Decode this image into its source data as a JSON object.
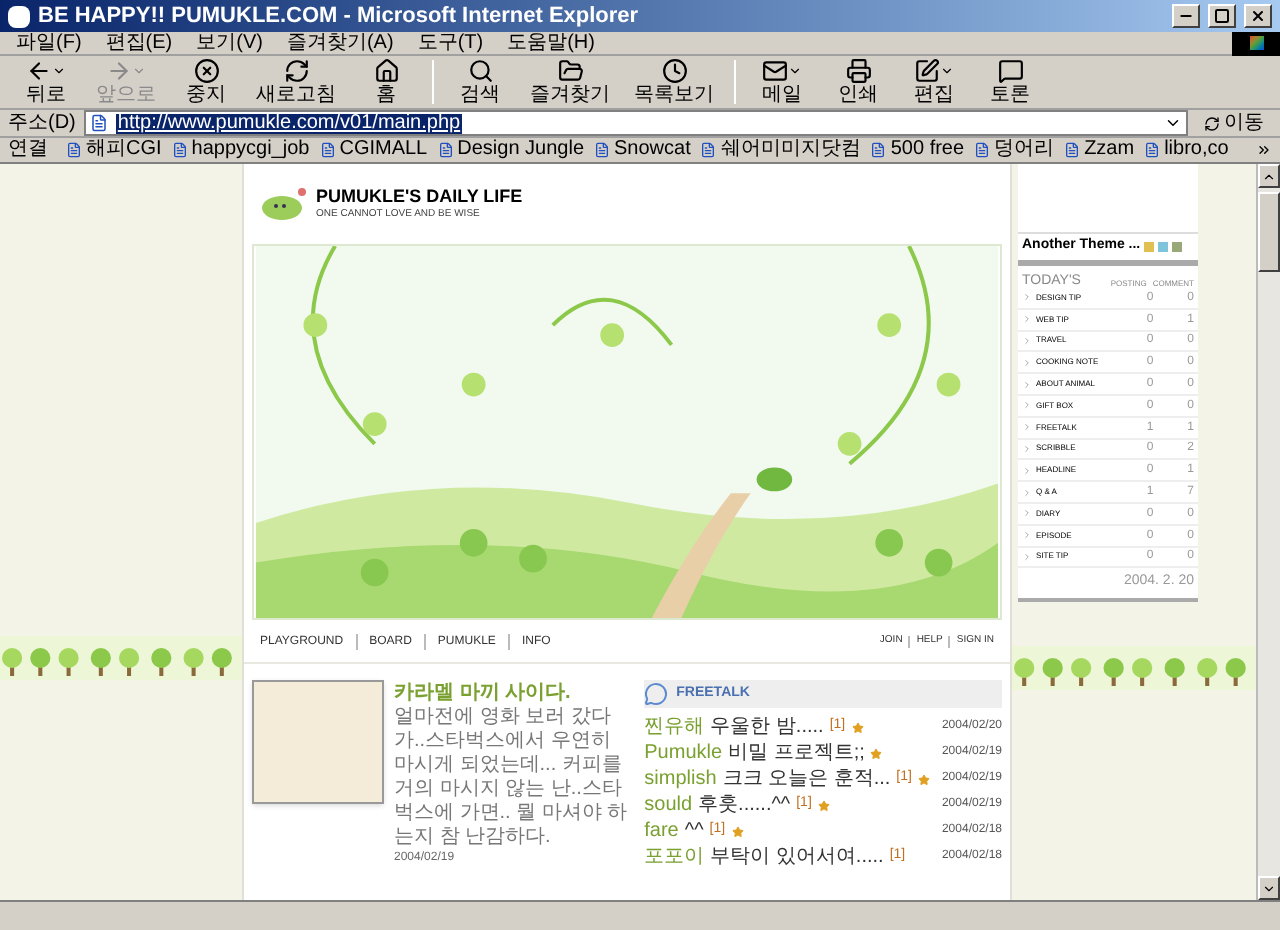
{
  "window": {
    "title": "BE HAPPY!! PUMUKLE.COM - Microsoft Internet Explorer"
  },
  "menu": [
    "파일(F)",
    "편집(E)",
    "보기(V)",
    "즐겨찾기(A)",
    "도구(T)",
    "도움말(H)"
  ],
  "toolbar": [
    {
      "label": "뒤로",
      "disabled": false,
      "dropdown": true
    },
    {
      "label": "앞으로",
      "disabled": true,
      "dropdown": true
    },
    {
      "label": "중지",
      "disabled": false,
      "dropdown": false
    },
    {
      "label": "새로고침",
      "disabled": false,
      "dropdown": false
    },
    {
      "label": "홈",
      "disabled": false,
      "dropdown": false
    },
    {
      "label": "검색",
      "disabled": false,
      "dropdown": false
    },
    {
      "label": "즐겨찾기",
      "disabled": false,
      "dropdown": false
    },
    {
      "label": "목록보기",
      "disabled": false,
      "dropdown": false
    },
    {
      "label": "메일",
      "disabled": false,
      "dropdown": true
    },
    {
      "label": "인쇄",
      "disabled": false,
      "dropdown": false
    },
    {
      "label": "편집",
      "disabled": false,
      "dropdown": true
    },
    {
      "label": "토론",
      "disabled": false,
      "dropdown": false
    }
  ],
  "address": {
    "label": "주소(D)",
    "value": "http://www.pumukle.com/v01/main.php",
    "go": "이동"
  },
  "links": {
    "label": "연결",
    "items": [
      "해피CGI",
      "happycgi_job",
      "CGIMALL",
      "Design Jungle",
      "Snowcat",
      "쉐어미미지닷컴",
      "500 free",
      "덩어리",
      "Zzam",
      "libro,co"
    ]
  },
  "page": {
    "logo": {
      "title": "PUMUKLE'S DAILY LIFE",
      "subtitle": "ONE CANNOT LOVE AND BE WISE"
    },
    "nav": [
      "PLAYGROUND",
      "BOARD",
      "PUMUKLE",
      "INFO"
    ],
    "member_links": [
      "JOIN",
      "HELP",
      "SIGN IN"
    ],
    "post": {
      "title": "카라멜 마끼 사이다.",
      "body": "얼마전에 영화 보러 갔다가..스타벅스에서 우연히 마시게 되었는데... 커피를 거의 마시지 않는 난..스타벅스에 가면.. 뭘 마셔야 하는지 참 난감하다.",
      "date": "2004/02/19"
    },
    "freetalk": {
      "title": "FREETALK",
      "rows": [
        {
          "author": "찐유해",
          "title": "우울한 밤.....",
          "count": "[1]",
          "new": true,
          "date": "2004/02/20"
        },
        {
          "author": "Pumukle",
          "title": "비밀 프로젝트;;",
          "new": true,
          "date": "2004/02/19"
        },
        {
          "author": "simplish",
          "title": "크크 오늘은 훈적...",
          "count": "[1]",
          "new": true,
          "date": "2004/02/19"
        },
        {
          "author": "sould",
          "title": "후훗......^^",
          "count": "[1]",
          "new": true,
          "date": "2004/02/19"
        },
        {
          "author": "fare",
          "title": "^^",
          "count": "[1]",
          "new": true,
          "date": "2004/02/18"
        },
        {
          "author": "포포이",
          "title": "부탁이 있어서여.....",
          "count": "[1]",
          "new": false,
          "date": "2004/02/18"
        }
      ]
    }
  },
  "sidebar": {
    "theme_title": "Another Theme ...",
    "themes": [
      {
        "color": "#e0c050"
      },
      {
        "color": "#80c4dc"
      },
      {
        "color": "#98a878"
      }
    ],
    "columns": [
      "TODAY'S",
      "POSTING",
      "COMMENT"
    ],
    "rows": [
      {
        "label": "DESIGN TIP",
        "posting": "0",
        "comment": "0"
      },
      {
        "label": "WEB TIP",
        "posting": "0",
        "comment": "1"
      },
      {
        "label": "TRAVEL",
        "posting": "0",
        "comment": "0"
      },
      {
        "label": "COOKING NOTE",
        "posting": "0",
        "comment": "0"
      },
      {
        "label": "ABOUT ANIMAL",
        "posting": "0",
        "comment": "0"
      },
      {
        "label": "GIFT BOX",
        "posting": "0",
        "comment": "0"
      },
      {
        "label": "FREETALK",
        "posting": "1",
        "comment": "1"
      },
      {
        "label": "SCRIBBLE",
        "posting": "0",
        "comment": "2"
      },
      {
        "label": "HEADLINE",
        "posting": "0",
        "comment": "1"
      },
      {
        "label": "Q & A",
        "posting": "1",
        "comment": "7"
      },
      {
        "label": "DIARY",
        "posting": "0",
        "comment": "0"
      },
      {
        "label": "EPISODE",
        "posting": "0",
        "comment": "0"
      },
      {
        "label": "SITE TIP",
        "posting": "0",
        "comment": "0"
      }
    ],
    "date": "2004. 2. 20"
  }
}
